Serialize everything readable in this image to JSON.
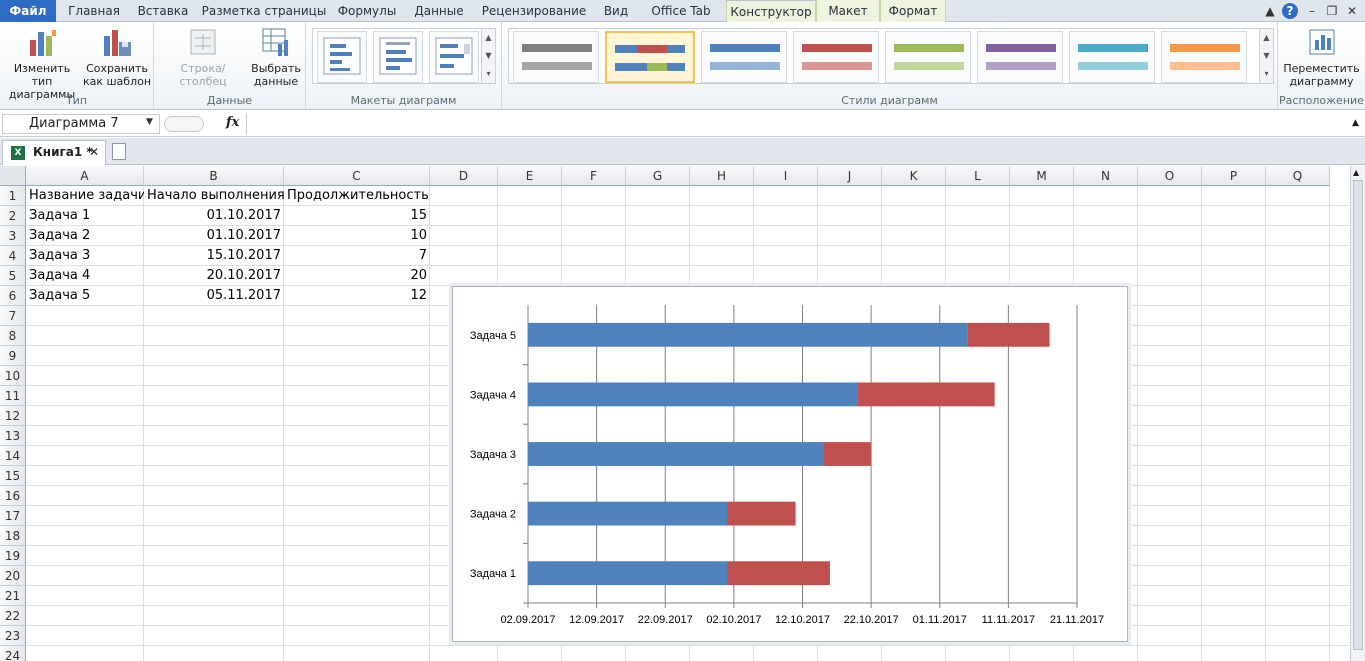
{
  "ribbon_tabs": [
    {
      "label": "Файл"
    },
    {
      "label": "Главная"
    },
    {
      "label": "Вставка"
    },
    {
      "label": "Разметка страницы"
    },
    {
      "label": "Формулы"
    },
    {
      "label": "Данные"
    },
    {
      "label": "Рецензирование"
    },
    {
      "label": "Вид"
    },
    {
      "label": "Office Tab"
    },
    {
      "label": "Конструктор"
    },
    {
      "label": "Макет"
    },
    {
      "label": "Формат"
    }
  ],
  "active_tab": "Конструктор",
  "ribbon": {
    "type_group": {
      "label": "Тип",
      "change_type": "Изменить тип диаграммы",
      "save_template": "Сохранить как шаблон"
    },
    "data_group": {
      "label": "Данные",
      "switch_row_col": "Строка/столбец",
      "select_data": "Выбрать данные"
    },
    "layouts_group": {
      "label": "Макеты диаграмм"
    },
    "styles_group": {
      "label": "Стили диаграмм"
    },
    "location_group": {
      "label": "Расположение",
      "move_chart": "Переместить диаграмму"
    },
    "style_colors": [
      "#7f7f7f",
      "#4f81bd",
      "#4f81bd",
      "#c0504d",
      "#9bbb59",
      "#8064a2",
      "#4bacc6",
      "#f79646"
    ]
  },
  "formula_bar": {
    "name_box": "Диаграмма 7",
    "fx": "fx",
    "value": ""
  },
  "workbook_tab": {
    "label": "Книга1 *"
  },
  "columns": [
    "A",
    "B",
    "C",
    "D",
    "E",
    "F",
    "G",
    "H",
    "I",
    "J",
    "K",
    "L",
    "M",
    "N",
    "O",
    "P",
    "Q"
  ],
  "rows": [
    "1",
    "2",
    "3",
    "4",
    "5",
    "6",
    "7",
    "8",
    "9",
    "10",
    "11",
    "12",
    "13",
    "14",
    "15",
    "16",
    "17",
    "18",
    "19",
    "20",
    "21",
    "22",
    "23",
    "24"
  ],
  "table": {
    "headers": [
      "Название задачи",
      "Начало выполнения",
      "Продолжительность"
    ],
    "rows": [
      [
        "Задача 1",
        "01.10.2017",
        "15"
      ],
      [
        "Задача 2",
        "01.10.2017",
        "10"
      ],
      [
        "Задача 3",
        "15.10.2017",
        "7"
      ],
      [
        "Задача 4",
        "20.10.2017",
        "20"
      ],
      [
        "Задача 5",
        "05.11.2017",
        "12"
      ]
    ]
  },
  "chart_data": {
    "type": "bar",
    "orientation": "horizontal",
    "stacked": true,
    "categories": [
      "Задача 1",
      "Задача 2",
      "Задача 3",
      "Задача 4",
      "Задача 5"
    ],
    "series": [
      {
        "values": [
          "01.10.2017",
          "01.10.2017",
          "15.10.2017",
          "20.10.2017",
          "05.11.2017"
        ],
        "color": "#4f81bd"
      },
      {
        "values": [
          15,
          10,
          7,
          20,
          12
        ],
        "color": "#c0504d"
      }
    ],
    "x_ticks": [
      "02.09.2017",
      "12.09.2017",
      "22.09.2017",
      "02.10.2017",
      "12.10.2017",
      "22.10.2017",
      "01.11.2017",
      "11.11.2017",
      "21.11.2017"
    ],
    "xlim": [
      "02.09.2017",
      "21.11.2017"
    ],
    "grid": "vertical",
    "legend": "none",
    "title": ""
  }
}
